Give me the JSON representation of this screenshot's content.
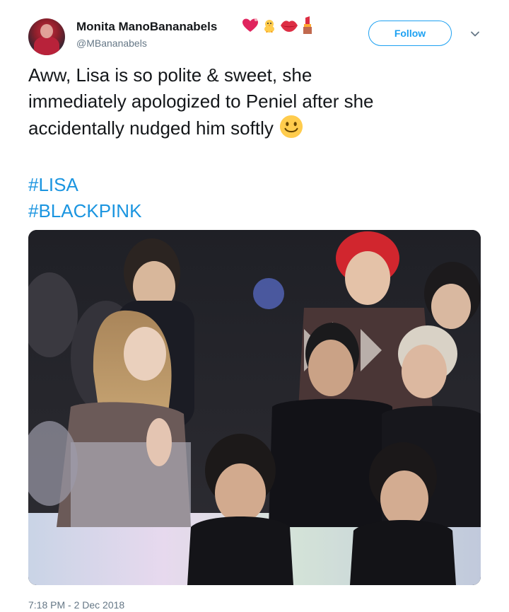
{
  "author": {
    "display_name": "Monita ManoBananabels",
    "handle": "@MBananabels",
    "name_emojis": [
      "heart-icon",
      "chick-icon",
      "lips-icon",
      "lipstick-icon"
    ]
  },
  "follow_button": {
    "label": "Follow"
  },
  "tweet": {
    "text_lines": [
      "Aww, Lisa is so polite & sweet, she",
      "immediately apologized to Peniel after she",
      "accidentally nudged him softly"
    ],
    "trailing_emoji": "smiling-face-icon",
    "hashtags": [
      "#LISA",
      "#BLACKPINK"
    ]
  },
  "media": {
    "type": "video-still"
  },
  "timestamp": "7:18 PM - 2 Dec 2018",
  "colors": {
    "link_blue": "#1b95e0",
    "follow_blue": "#1da1f2",
    "secondary_text": "#657786",
    "primary_text": "#14171a"
  }
}
